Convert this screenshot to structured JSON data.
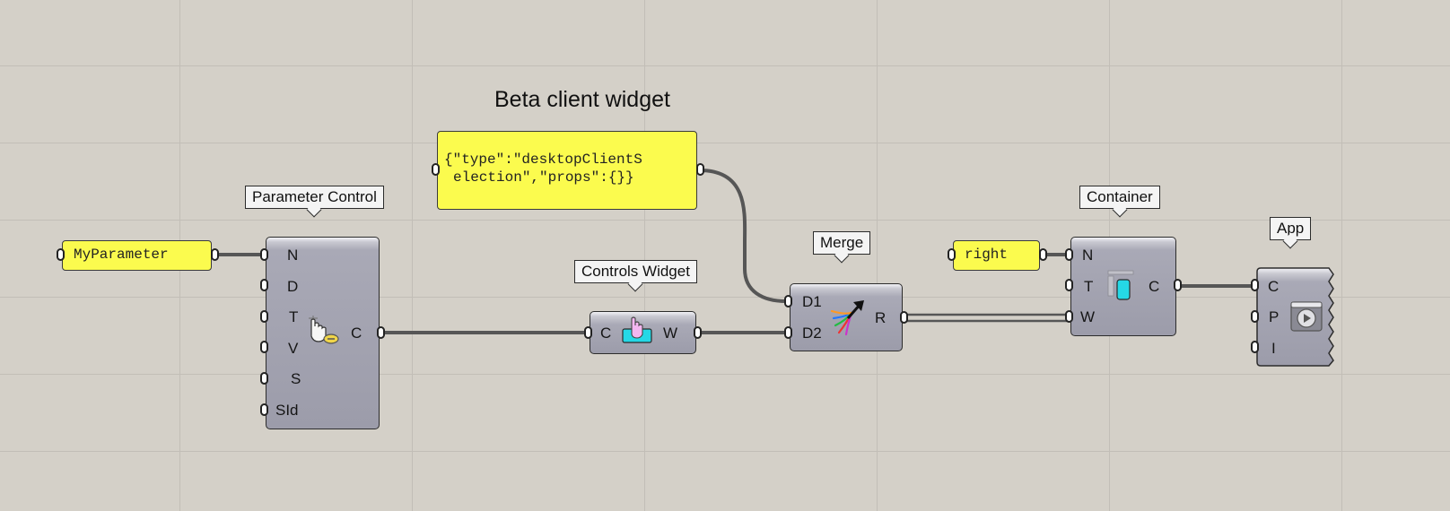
{
  "group": {
    "title": "Beta client widget"
  },
  "panels": {
    "parameter": "MyParameter",
    "json_line1": "{\"type\":\"desktopClientS",
    "json_line2": "election\",\"props\":{}}",
    "right": "right"
  },
  "components": {
    "parameter_control": {
      "tag": "Parameter Control",
      "inputs": [
        "N",
        "D",
        "T",
        "V",
        "S",
        "SId"
      ],
      "output": "C",
      "icon": "hand-key-icon"
    },
    "controls_widget": {
      "tag": "Controls Widget",
      "input": "C",
      "output": "W",
      "icon": "hand-tray-icon"
    },
    "merge": {
      "tag": "Merge",
      "inputs": [
        "D1",
        "D2"
      ],
      "output": "R",
      "icon": "merge-arrows-icon"
    },
    "container": {
      "tag": "Container",
      "inputs": [
        "N",
        "T",
        "W"
      ],
      "output": "C",
      "icon": "container-icon"
    },
    "app": {
      "tag": "App",
      "inputs": [
        "C",
        "P",
        "I"
      ],
      "icon": "app-play-icon"
    }
  },
  "colors": {
    "canvas": "#d4d0c8",
    "panel": "#fbfb4e",
    "wire": "#5a5a5a",
    "cyan_accent": "#25d8e6"
  }
}
